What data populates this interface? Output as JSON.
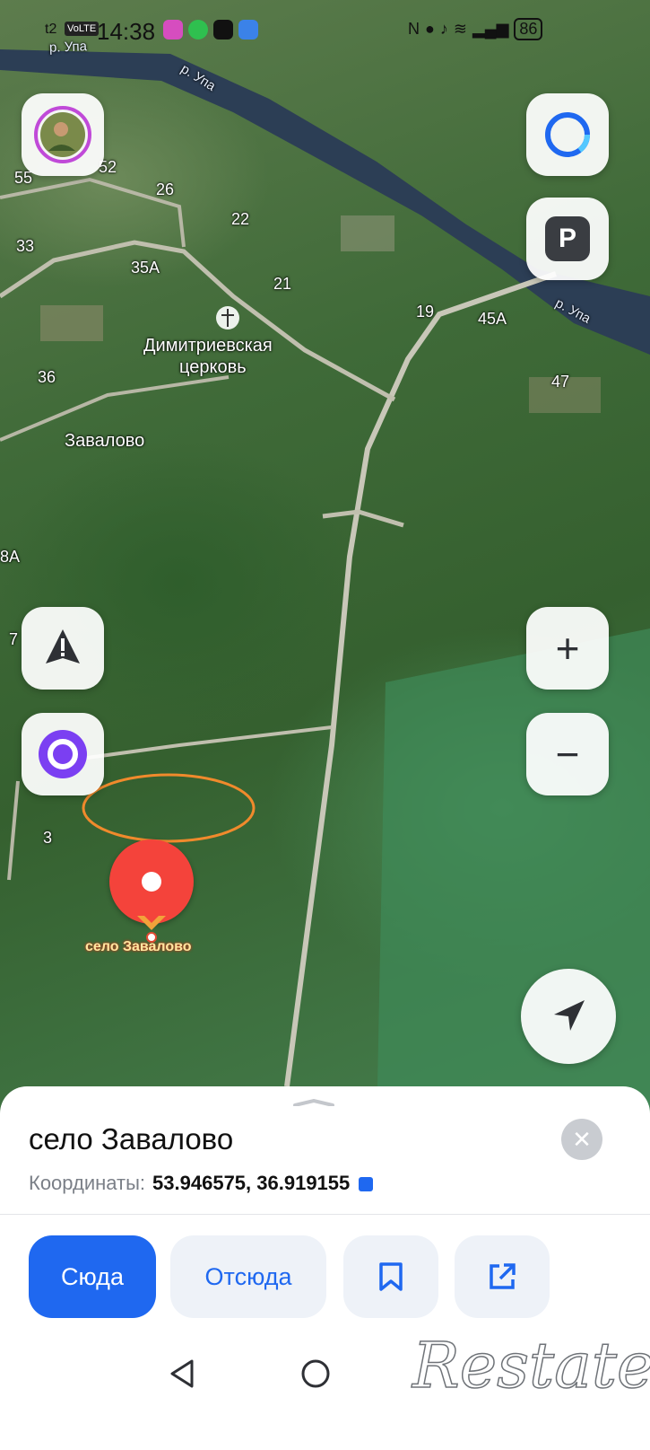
{
  "status_bar": {
    "carrier": "t2",
    "network_badge": "VoLTE",
    "time": "14:38",
    "battery": "86"
  },
  "map": {
    "type": "satellite",
    "labels": {
      "river_top": "р. Упа",
      "river_mid": "р. Упа",
      "river_right": "р. Упа",
      "house_55": "55",
      "house_52": "52",
      "house_26": "26",
      "house_22": "22",
      "house_33": "33",
      "house_35a": "35А",
      "house_21": "21",
      "house_19": "19",
      "house_45a": "45А",
      "house_36": "36",
      "house_47": "47",
      "house_8a": "8А",
      "house_7": "7",
      "house_3": "3",
      "church_line1": "Димитриевская",
      "church_line2": "церковь",
      "village": "Завалово"
    },
    "pin_label": "село Завалово",
    "annotation_color": "#f08a2c"
  },
  "controls": {
    "profile_icon": "avatar-icon",
    "alice_icon": "alice-assistant-icon",
    "parking_label": "P",
    "zoom_in": "+",
    "zoom_out": "−"
  },
  "sheet": {
    "title": "село Завалово",
    "coords_label": "Координаты:",
    "coords_value": "53.946575, 36.919155",
    "buttons": {
      "to_here": "Сюда",
      "from_here": "Отсюда"
    }
  },
  "watermark": "Restate",
  "colors": {
    "accent": "#1f68f0",
    "pin": "#f4433b",
    "alice": "#7b3ff2"
  }
}
